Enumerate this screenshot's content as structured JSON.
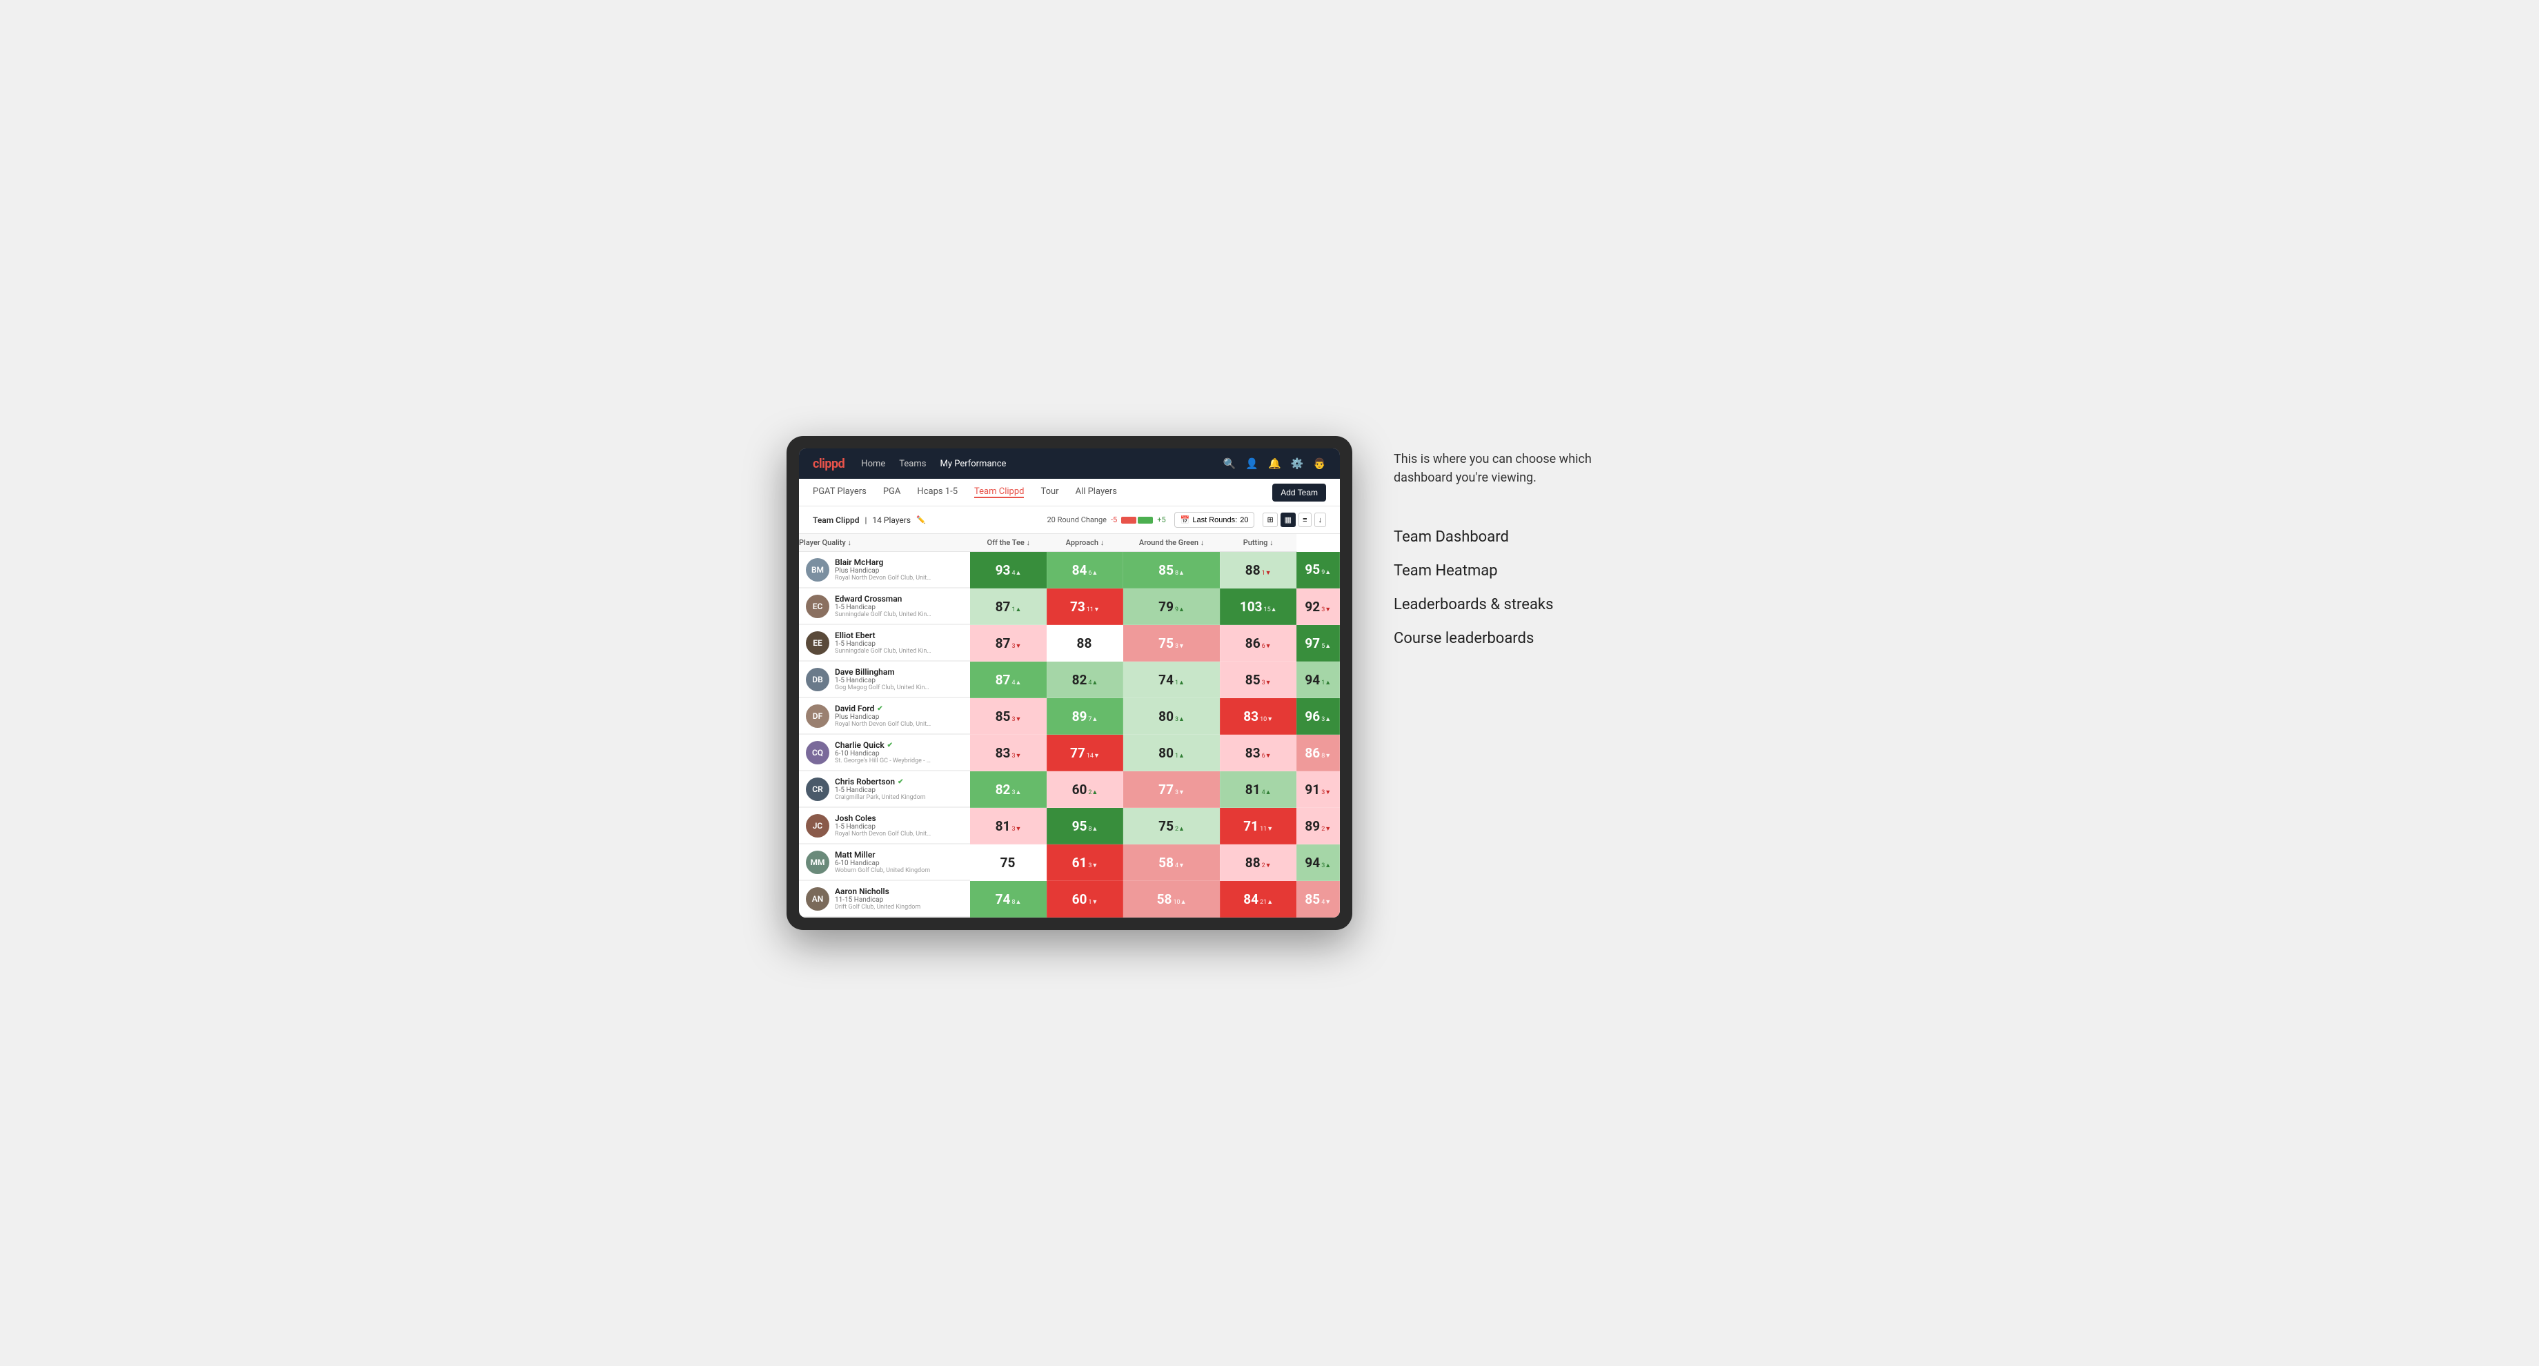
{
  "annotation": {
    "description": "This is where you can choose which dashboard you're viewing.",
    "menu_items": [
      "Team Dashboard",
      "Team Heatmap",
      "Leaderboards & streaks",
      "Course leaderboards"
    ]
  },
  "nav": {
    "logo": "clippd",
    "links": [
      "Home",
      "Teams",
      "My Performance"
    ],
    "active_link": "My Performance"
  },
  "sub_nav": {
    "links": [
      "PGAT Players",
      "PGA",
      "Hcaps 1-5",
      "Team Clippd",
      "Tour",
      "All Players"
    ],
    "active_link": "Team Clippd",
    "add_team_label": "Add Team"
  },
  "team_header": {
    "name": "Team Clippd",
    "player_count": "14 Players",
    "round_change_label": "20 Round Change",
    "change_minus": "-5",
    "change_plus": "+5",
    "last_rounds_label": "Last Rounds:",
    "last_rounds_value": "20"
  },
  "table": {
    "columns": [
      {
        "id": "player",
        "label": "Player Quality ↓"
      },
      {
        "id": "off_tee",
        "label": "Off the Tee ↓"
      },
      {
        "id": "approach",
        "label": "Approach ↓"
      },
      {
        "id": "around_green",
        "label": "Around the Green ↓"
      },
      {
        "id": "putting",
        "label": "Putting ↓"
      }
    ],
    "rows": [
      {
        "name": "Blair McHarg",
        "hcp": "Plus Handicap",
        "club": "Royal North Devon Golf Club, United Kingdom",
        "avatar_color": "#7b8fa0",
        "initials": "BM",
        "player_quality": {
          "value": 93,
          "change": "4▲",
          "dir": "up",
          "bg": "bg-dark-green",
          "white": true
        },
        "off_tee": {
          "value": 84,
          "change": "6▲",
          "dir": "up",
          "bg": "bg-medium-green",
          "white": true
        },
        "approach": {
          "value": 85,
          "change": "8▲",
          "dir": "up",
          "bg": "bg-medium-green",
          "white": true
        },
        "around_green": {
          "value": 88,
          "change": "1▼",
          "dir": "down",
          "bg": "bg-very-light-green",
          "white": false
        },
        "putting": {
          "value": 95,
          "change": "9▲",
          "dir": "up",
          "bg": "bg-dark-green",
          "white": true
        }
      },
      {
        "name": "Edward Crossman",
        "hcp": "1-5 Handicap",
        "club": "Sunningdale Golf Club, United Kingdom",
        "avatar_color": "#8a7060",
        "initials": "EC",
        "player_quality": {
          "value": 87,
          "change": "1▲",
          "dir": "up",
          "bg": "bg-very-light-green",
          "white": false
        },
        "off_tee": {
          "value": 73,
          "change": "11▼",
          "dir": "down",
          "bg": "bg-dark-red",
          "white": true
        },
        "approach": {
          "value": 79,
          "change": "9▲",
          "dir": "up",
          "bg": "bg-light-green",
          "white": false
        },
        "around_green": {
          "value": 103,
          "change": "15▲",
          "dir": "up",
          "bg": "bg-dark-green",
          "white": true
        },
        "putting": {
          "value": 92,
          "change": "3▼",
          "dir": "down",
          "bg": "bg-light-red",
          "white": false
        }
      },
      {
        "name": "Elliot Ebert",
        "hcp": "1-5 Handicap",
        "club": "Sunningdale Golf Club, United Kingdom",
        "avatar_color": "#5a4a3a",
        "initials": "EE",
        "player_quality": {
          "value": 87,
          "change": "3▼",
          "dir": "down",
          "bg": "bg-light-red",
          "white": false
        },
        "off_tee": {
          "value": 88,
          "change": "",
          "dir": "none",
          "bg": "bg-white",
          "white": false
        },
        "approach": {
          "value": 75,
          "change": "3▼",
          "dir": "down",
          "bg": "bg-medium-red",
          "white": true
        },
        "around_green": {
          "value": 86,
          "change": "6▼",
          "dir": "down",
          "bg": "bg-light-red",
          "white": false
        },
        "putting": {
          "value": 97,
          "change": "5▲",
          "dir": "up",
          "bg": "bg-dark-green",
          "white": true
        }
      },
      {
        "name": "Dave Billingham",
        "hcp": "1-5 Handicap",
        "club": "Gog Magog Golf Club, United Kingdom",
        "avatar_color": "#6a7a8a",
        "initials": "DB",
        "player_quality": {
          "value": 87,
          "change": "4▲",
          "dir": "up",
          "bg": "bg-medium-green",
          "white": true
        },
        "off_tee": {
          "value": 82,
          "change": "4▲",
          "dir": "up",
          "bg": "bg-light-green",
          "white": false
        },
        "approach": {
          "value": 74,
          "change": "1▲",
          "dir": "up",
          "bg": "bg-very-light-green",
          "white": false
        },
        "around_green": {
          "value": 85,
          "change": "3▼",
          "dir": "down",
          "bg": "bg-light-red",
          "white": false
        },
        "putting": {
          "value": 94,
          "change": "1▲",
          "dir": "up",
          "bg": "bg-light-green",
          "white": false
        }
      },
      {
        "name": "David Ford",
        "hcp": "Plus Handicap",
        "club": "Royal North Devon Golf Club, United Kingdom",
        "avatar_color": "#9a8070",
        "initials": "DF",
        "verified": true,
        "player_quality": {
          "value": 85,
          "change": "3▼",
          "dir": "down",
          "bg": "bg-light-red",
          "white": false
        },
        "off_tee": {
          "value": 89,
          "change": "7▲",
          "dir": "up",
          "bg": "bg-medium-green",
          "white": true
        },
        "approach": {
          "value": 80,
          "change": "3▲",
          "dir": "up",
          "bg": "bg-very-light-green",
          "white": false
        },
        "around_green": {
          "value": 83,
          "change": "10▼",
          "dir": "down",
          "bg": "bg-dark-red",
          "white": true
        },
        "putting": {
          "value": 96,
          "change": "3▲",
          "dir": "up",
          "bg": "bg-dark-green",
          "white": true
        }
      },
      {
        "name": "Charlie Quick",
        "hcp": "6-10 Handicap",
        "club": "St. George's Hill GC - Weybridge - Surrey, Uni...",
        "avatar_color": "#7a6a9a",
        "initials": "CQ",
        "verified": true,
        "player_quality": {
          "value": 83,
          "change": "3▼",
          "dir": "down",
          "bg": "bg-light-red",
          "white": false
        },
        "off_tee": {
          "value": 77,
          "change": "14▼",
          "dir": "down",
          "bg": "bg-dark-red",
          "white": true
        },
        "approach": {
          "value": 80,
          "change": "1▲",
          "dir": "up",
          "bg": "bg-very-light-green",
          "white": false
        },
        "around_green": {
          "value": 83,
          "change": "6▼",
          "dir": "down",
          "bg": "bg-light-red",
          "white": false
        },
        "putting": {
          "value": 86,
          "change": "8▼",
          "dir": "down",
          "bg": "bg-medium-red",
          "white": true
        }
      },
      {
        "name": "Chris Robertson",
        "hcp": "1-5 Handicap",
        "club": "Craigmillar Park, United Kingdom",
        "avatar_color": "#4a5a6a",
        "initials": "CR",
        "verified": true,
        "player_quality": {
          "value": 82,
          "change": "3▲",
          "dir": "up",
          "bg": "bg-medium-green",
          "white": true
        },
        "off_tee": {
          "value": 60,
          "change": "2▲",
          "dir": "up",
          "bg": "bg-light-red",
          "white": false
        },
        "approach": {
          "value": 77,
          "change": "3▼",
          "dir": "down",
          "bg": "bg-medium-red",
          "white": true
        },
        "around_green": {
          "value": 81,
          "change": "4▲",
          "dir": "up",
          "bg": "bg-light-green",
          "white": false
        },
        "putting": {
          "value": 91,
          "change": "3▼",
          "dir": "down",
          "bg": "bg-light-red",
          "white": false
        }
      },
      {
        "name": "Josh Coles",
        "hcp": "1-5 Handicap",
        "club": "Royal North Devon Golf Club, United Kingdom",
        "avatar_color": "#8a5a4a",
        "initials": "JC",
        "player_quality": {
          "value": 81,
          "change": "3▼",
          "dir": "down",
          "bg": "bg-light-red",
          "white": false
        },
        "off_tee": {
          "value": 95,
          "change": "8▲",
          "dir": "up",
          "bg": "bg-dark-green",
          "white": true
        },
        "approach": {
          "value": 75,
          "change": "2▲",
          "dir": "up",
          "bg": "bg-very-light-green",
          "white": false
        },
        "around_green": {
          "value": 71,
          "change": "11▼",
          "dir": "down",
          "bg": "bg-dark-red",
          "white": true
        },
        "putting": {
          "value": 89,
          "change": "2▼",
          "dir": "down",
          "bg": "bg-light-red",
          "white": false
        }
      },
      {
        "name": "Matt Miller",
        "hcp": "6-10 Handicap",
        "club": "Woburn Golf Club, United Kingdom",
        "avatar_color": "#6a8a7a",
        "initials": "MM",
        "player_quality": {
          "value": 75,
          "change": "",
          "dir": "none",
          "bg": "bg-white",
          "white": false
        },
        "off_tee": {
          "value": 61,
          "change": "3▼",
          "dir": "down",
          "bg": "bg-dark-red",
          "white": true
        },
        "approach": {
          "value": 58,
          "change": "4▼",
          "dir": "down",
          "bg": "bg-medium-red",
          "white": true
        },
        "around_green": {
          "value": 88,
          "change": "2▼",
          "dir": "down",
          "bg": "bg-light-red",
          "white": false
        },
        "putting": {
          "value": 94,
          "change": "3▲",
          "dir": "up",
          "bg": "bg-light-green",
          "white": false
        }
      },
      {
        "name": "Aaron Nicholls",
        "hcp": "11-15 Handicap",
        "club": "Drift Golf Club, United Kingdom",
        "avatar_color": "#7a6a5a",
        "initials": "AN",
        "player_quality": {
          "value": 74,
          "change": "8▲",
          "dir": "up",
          "bg": "bg-medium-green",
          "white": true
        },
        "off_tee": {
          "value": 60,
          "change": "1▼",
          "dir": "down",
          "bg": "bg-dark-red",
          "white": true
        },
        "approach": {
          "value": 58,
          "change": "10▲",
          "dir": "up",
          "bg": "bg-medium-red",
          "white": true
        },
        "around_green": {
          "value": 84,
          "change": "21▲",
          "dir": "up",
          "bg": "bg-dark-red",
          "white": true
        },
        "putting": {
          "value": 85,
          "change": "4▼",
          "dir": "down",
          "bg": "bg-medium-red",
          "white": true
        }
      }
    ]
  }
}
